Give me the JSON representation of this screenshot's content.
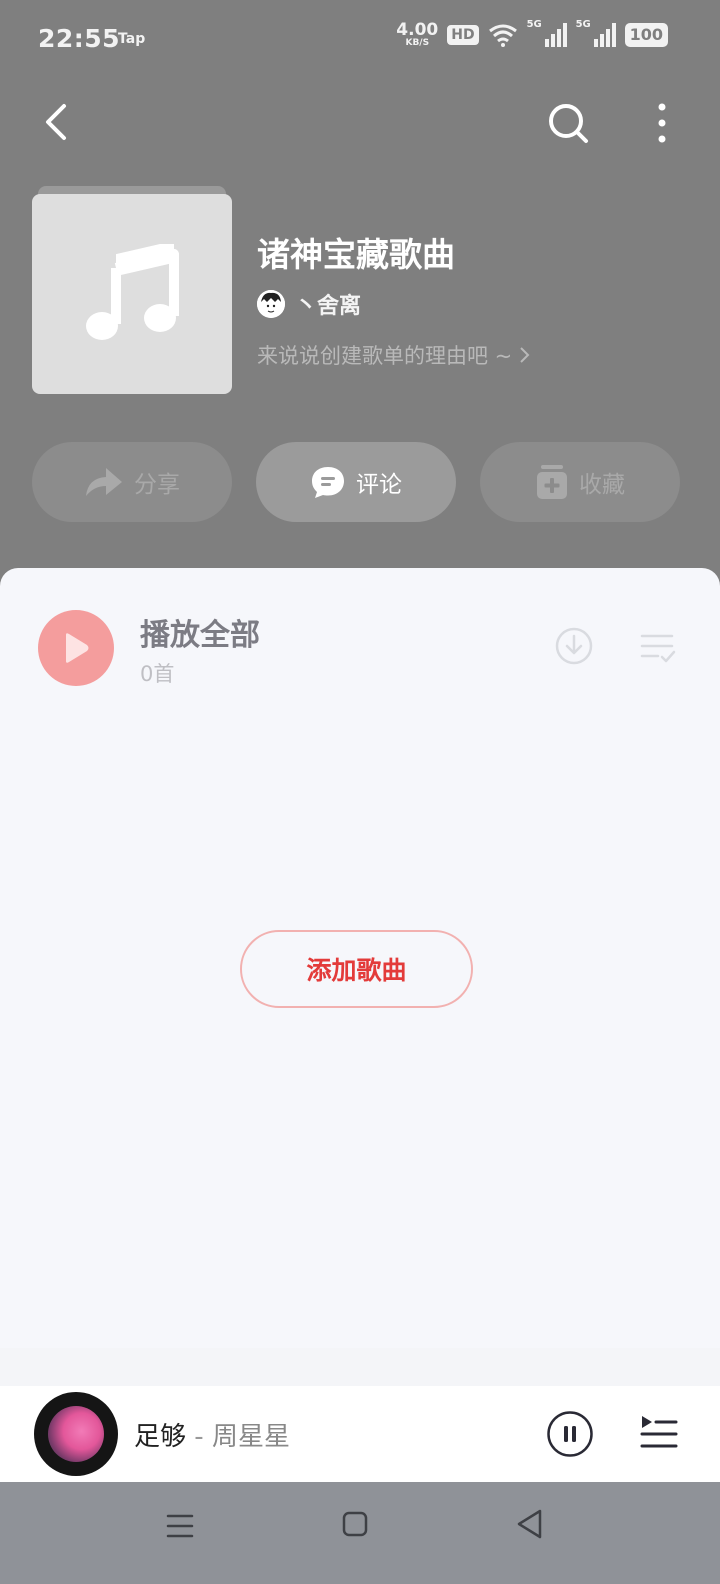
{
  "status_bar": {
    "time": "22:55",
    "tap_label": "Tap",
    "net_speed_value": "4.00",
    "net_speed_unit": "KB/S",
    "hd_label": "HD",
    "sim1_label": "5G",
    "sim2_label": "5G",
    "battery": "100"
  },
  "playlist": {
    "title": "诸神宝藏歌曲",
    "creator": "丶舍离",
    "description": "来说说创建歌单的理由吧 ~",
    "cover_icon": "music-note-icon"
  },
  "actions": {
    "share_label": "分享",
    "comment_label": "评论",
    "collect_label": "收藏"
  },
  "song_list": {
    "play_all_label": "播放全部",
    "count_label": "0首",
    "add_song_label": "添加歌曲"
  },
  "now_playing": {
    "song": "足够",
    "separator": " - ",
    "artist": "周星星"
  },
  "colors": {
    "accent_red": "#e33b3a",
    "play_button": "#f49d9d",
    "header_bg": "#7f7f7f"
  }
}
